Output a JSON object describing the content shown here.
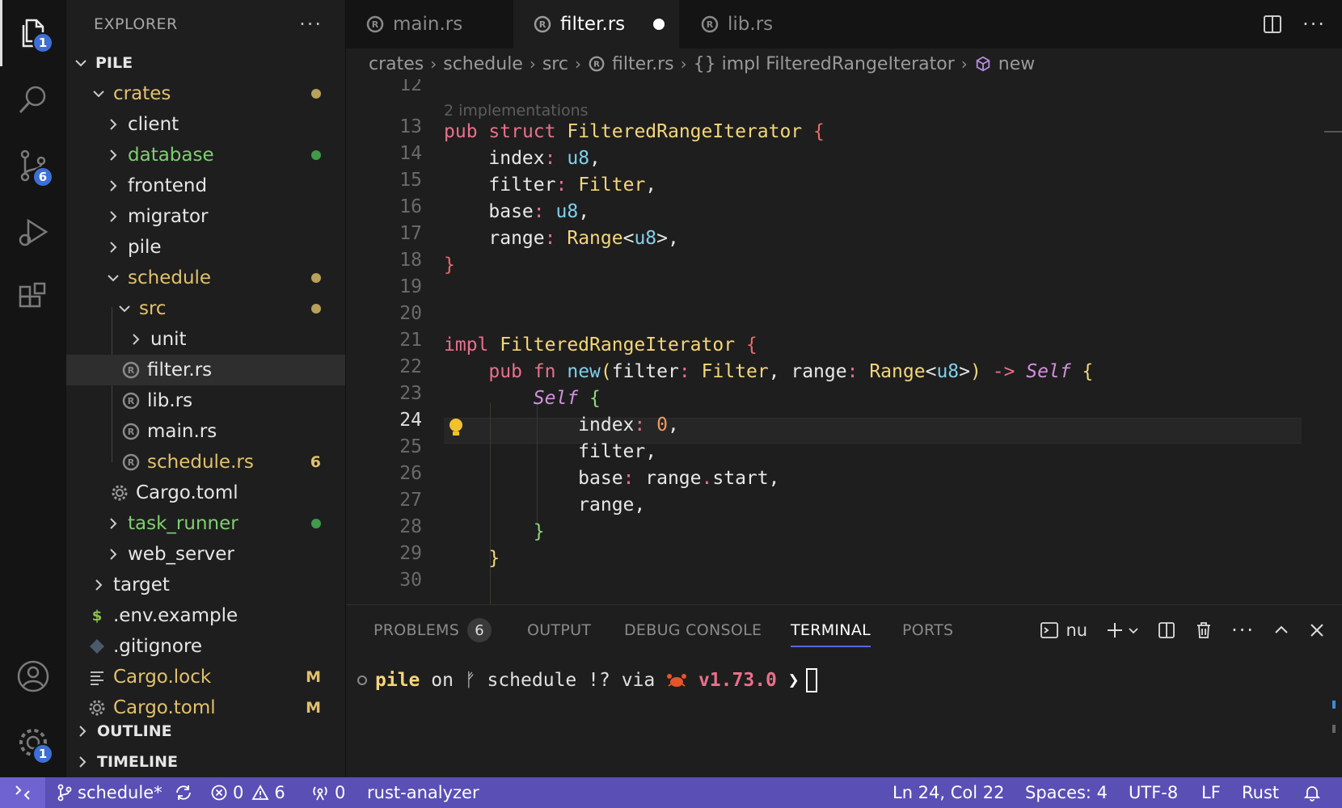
{
  "activity_bar": {
    "explorer_badge": "1",
    "scm_badge": "6",
    "settings_badge": "1"
  },
  "sidebar": {
    "title": "EXPLORER",
    "root": "PILE",
    "items": [
      {
        "label": "crates",
        "color": "#e2c16b"
      },
      {
        "label": "client",
        "color": "#e6e6e6"
      },
      {
        "label": "database",
        "color": "#7fcf6f"
      },
      {
        "label": "frontend",
        "color": "#e6e6e6"
      },
      {
        "label": "migrator",
        "color": "#e6e6e6"
      },
      {
        "label": "pile",
        "color": "#e6e6e6"
      },
      {
        "label": "schedule",
        "color": "#e2c16b"
      },
      {
        "label": "src",
        "color": "#e2c16b"
      },
      {
        "label": "unit",
        "color": "#e6e6e6"
      },
      {
        "label": "filter.rs",
        "color": "#e6e6e6"
      },
      {
        "label": "lib.rs",
        "color": "#e6e6e6"
      },
      {
        "label": "main.rs",
        "color": "#e6e6e6"
      },
      {
        "label": "schedule.rs",
        "color": "#e2c16b",
        "badge": "6"
      },
      {
        "label": "Cargo.toml",
        "color": "#e6e6e6"
      },
      {
        "label": "task_runner",
        "color": "#7fcf6f"
      },
      {
        "label": "web_server",
        "color": "#e6e6e6"
      },
      {
        "label": "target",
        "color": "#e6e6e6"
      },
      {
        "label": ".env.example",
        "color": "#e6e6e6",
        "icon_text": "$"
      },
      {
        "label": ".gitignore",
        "color": "#e6e6e6"
      },
      {
        "label": "Cargo.lock",
        "color": "#e2c16b",
        "badge": "M"
      },
      {
        "label": "Cargo.toml",
        "color": "#e2c16b",
        "badge": "M"
      }
    ],
    "outline": "OUTLINE",
    "timeline": "TIMELINE"
  },
  "tabs": [
    {
      "label": "main.rs"
    },
    {
      "label": "filter.rs"
    },
    {
      "label": "lib.rs"
    }
  ],
  "breadcrumb": {
    "parts": [
      "crates",
      "schedule",
      "src",
      "filter.rs",
      "{} impl FilteredRangeIterator",
      "new"
    ]
  },
  "editor": {
    "codelens": "2 implementations",
    "line_numbers": [
      "12",
      "13",
      "14",
      "15",
      "16",
      "17",
      "18",
      "19",
      "20",
      "21",
      "22",
      "23",
      "24",
      "25",
      "26",
      "27",
      "28",
      "29",
      "30"
    ],
    "current_line": "24"
  },
  "panel": {
    "tabs": [
      "PROBLEMS",
      "OUTPUT",
      "DEBUG CONSOLE",
      "TERMINAL",
      "PORTS"
    ],
    "problems_count": "6",
    "shell": "nu",
    "terminal": {
      "dir": "pile",
      "on": "on",
      "branch": "schedule",
      "flags": "!?",
      "via": "via",
      "version": "v1.73.0",
      "prompt": "❯"
    }
  },
  "status": {
    "branch": "schedule*",
    "errors": "0",
    "warnings": "6",
    "ports": "0",
    "analyzer": "rust-analyzer",
    "position": "Ln 24, Col 22",
    "spaces": "Spaces: 4",
    "encoding": "UTF-8",
    "eol": "LF",
    "language": "Rust"
  },
  "colors": {
    "accent": "#5a4fb5",
    "badge": "#3d6fd6",
    "modified": "#e2c16b",
    "untracked": "#7fcf6f"
  }
}
